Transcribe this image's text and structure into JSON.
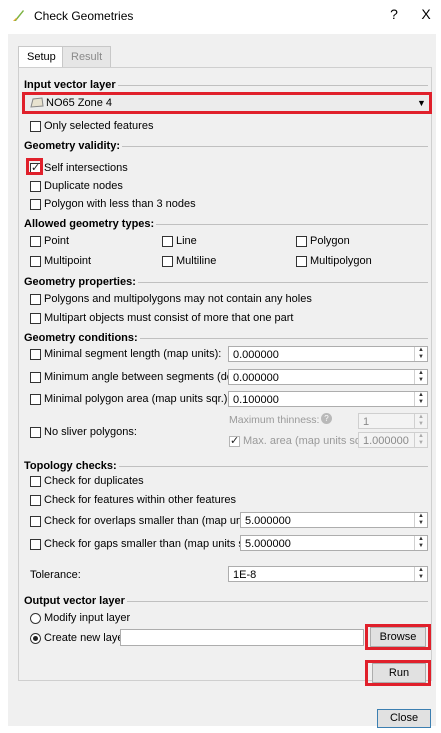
{
  "window": {
    "title": "Check Geometries",
    "help": "?",
    "close": "X"
  },
  "tabs": [
    {
      "label": "Setup",
      "active": true
    },
    {
      "label": "Result",
      "active": false
    }
  ],
  "input_layer": {
    "title": "Input vector layer",
    "selected": "NO65 Zone 4",
    "only_selected": "Only selected features"
  },
  "validity": {
    "title": "Geometry validity:",
    "items": [
      {
        "label": "Self intersections",
        "checked": true
      },
      {
        "label": "Duplicate nodes",
        "checked": false
      },
      {
        "label": "Polygon with less than 3 nodes",
        "checked": false
      }
    ]
  },
  "allowed": {
    "title": "Allowed geometry types:",
    "items": [
      "Point",
      "Line",
      "Polygon",
      "Multipoint",
      "Multiline",
      "Multipolygon"
    ]
  },
  "properties": {
    "title": "Geometry properties:",
    "items": [
      "Polygons and multipolygons may not contain any holes",
      "Multipart objects must consist of more that one part"
    ]
  },
  "conditions": {
    "title": "Geometry conditions:",
    "min_segment": {
      "label": "Minimal segment length (map units):",
      "value": "0.000000"
    },
    "min_angle": {
      "label": "Minimum angle between segments (deg):",
      "value": "0.000000"
    },
    "min_area": {
      "label": "Minimal polygon area (map units sqr.):",
      "value": "0.100000"
    },
    "sliver": {
      "label": "No sliver polygons:",
      "max_thinness_label": "Maximum thinness:",
      "max_thinness_value": "1",
      "max_area_label": "Max. area (map units sqr.):",
      "max_area_value": "1.000000"
    }
  },
  "topology": {
    "title": "Topology checks:",
    "duplicates": "Check for duplicates",
    "within": "Check for features within other features",
    "overlaps": {
      "label": "Check for overlaps smaller than (map units sqr.):",
      "value": "5.000000"
    },
    "gaps": {
      "label": "Check for gaps smaller than (map units sqr.):",
      "value": "5.000000"
    }
  },
  "tolerance": {
    "label": "Tolerance:",
    "value": "1E-8"
  },
  "output": {
    "title": "Output vector layer",
    "modify": "Modify input layer",
    "create": "Create new layer",
    "path": "",
    "browse": "Browse"
  },
  "actions": {
    "run": "Run",
    "close": "Close"
  },
  "colors": {
    "highlight": "#e0202b",
    "dialog_bg": "#f0f0f0"
  }
}
